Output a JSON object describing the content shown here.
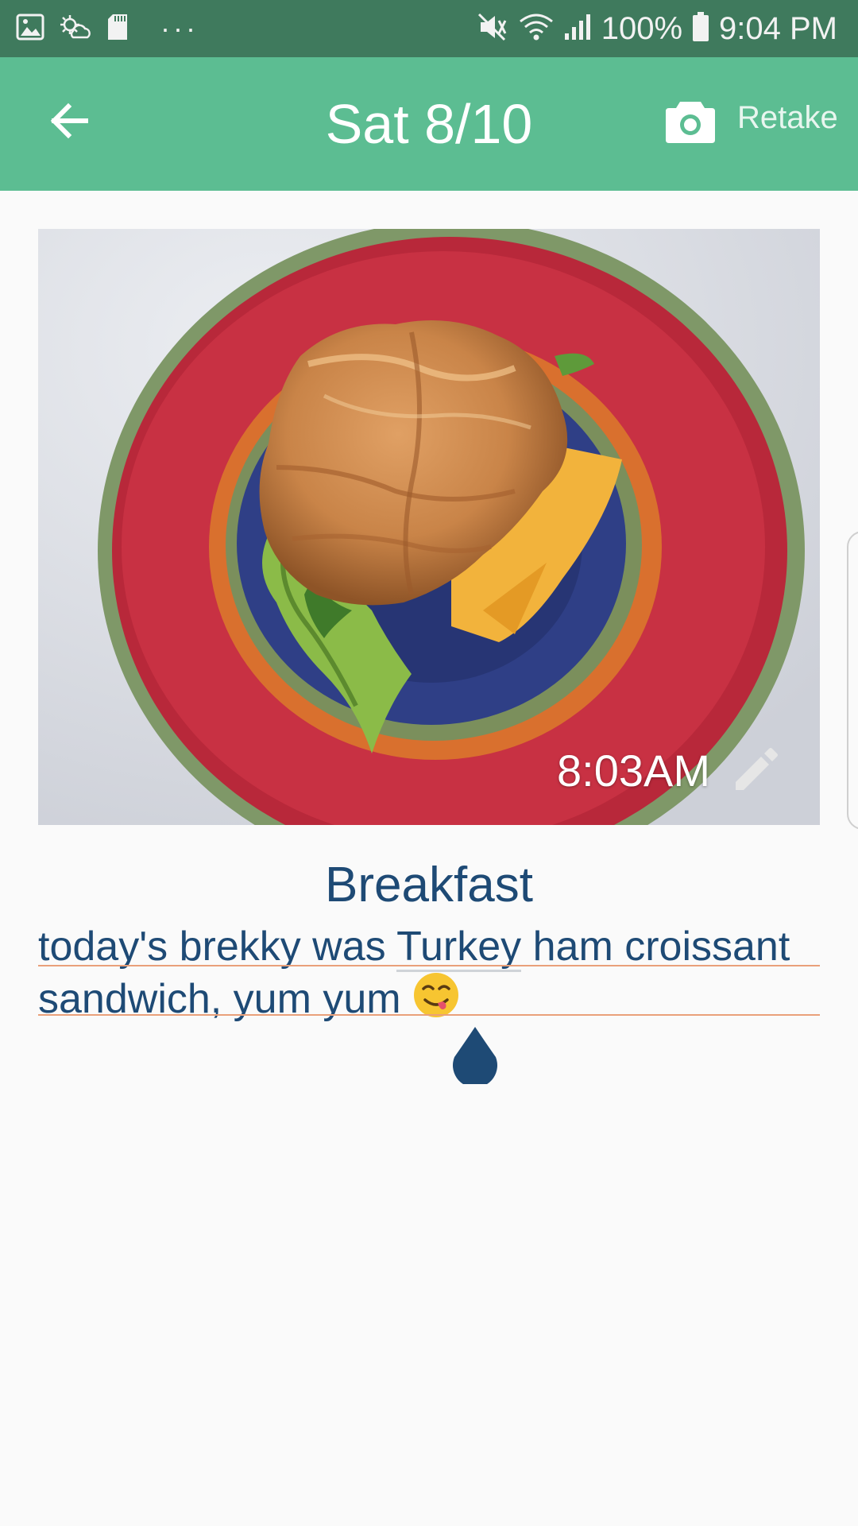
{
  "status_bar": {
    "battery_percent": "100%",
    "time": "9:04 PM",
    "more_label": "···"
  },
  "app_bar": {
    "title": "Sat 8/10",
    "retake_label": "Retake"
  },
  "photo": {
    "timestamp": "8:03AM"
  },
  "meal": {
    "type": "Breakfast",
    "note_line1_before": "today's brekky was ",
    "note_line1_highlight": "Turkey",
    "note_line1_after": " ham croissant",
    "note_line2": "sandwich, yum yum"
  },
  "colors": {
    "status_bar": "#3f7a5d",
    "app_bar": "#5cbd92",
    "text_primary": "#1e4a75"
  }
}
